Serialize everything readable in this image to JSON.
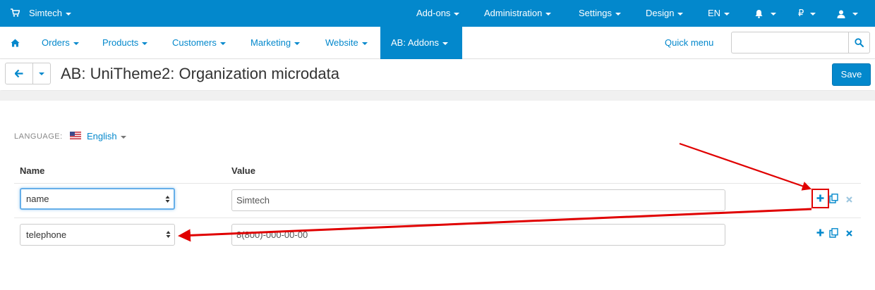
{
  "topbar": {
    "store_name": "Simtech",
    "menus": [
      "Add-ons",
      "Administration",
      "Settings",
      "Design",
      "EN"
    ],
    "currency": "₽"
  },
  "nav": {
    "items": [
      "Orders",
      "Products",
      "Customers",
      "Marketing",
      "Website",
      "AB: Addons"
    ],
    "quick_menu": "Quick menu",
    "search_value": ""
  },
  "title": {
    "text": "AB: UniTheme2: Organization microdata",
    "save_label": "Save"
  },
  "language": {
    "label": "LANGUAGE:",
    "value": "English"
  },
  "table": {
    "headers": {
      "name": "Name",
      "value": "Value"
    },
    "rows": [
      {
        "name": "name",
        "value": "Simtech"
      },
      {
        "name": "telephone",
        "value": "8(800)-000-00-00"
      }
    ]
  },
  "colors": {
    "brand_blue": "#0388cc",
    "annotation_red": "#e00000"
  }
}
